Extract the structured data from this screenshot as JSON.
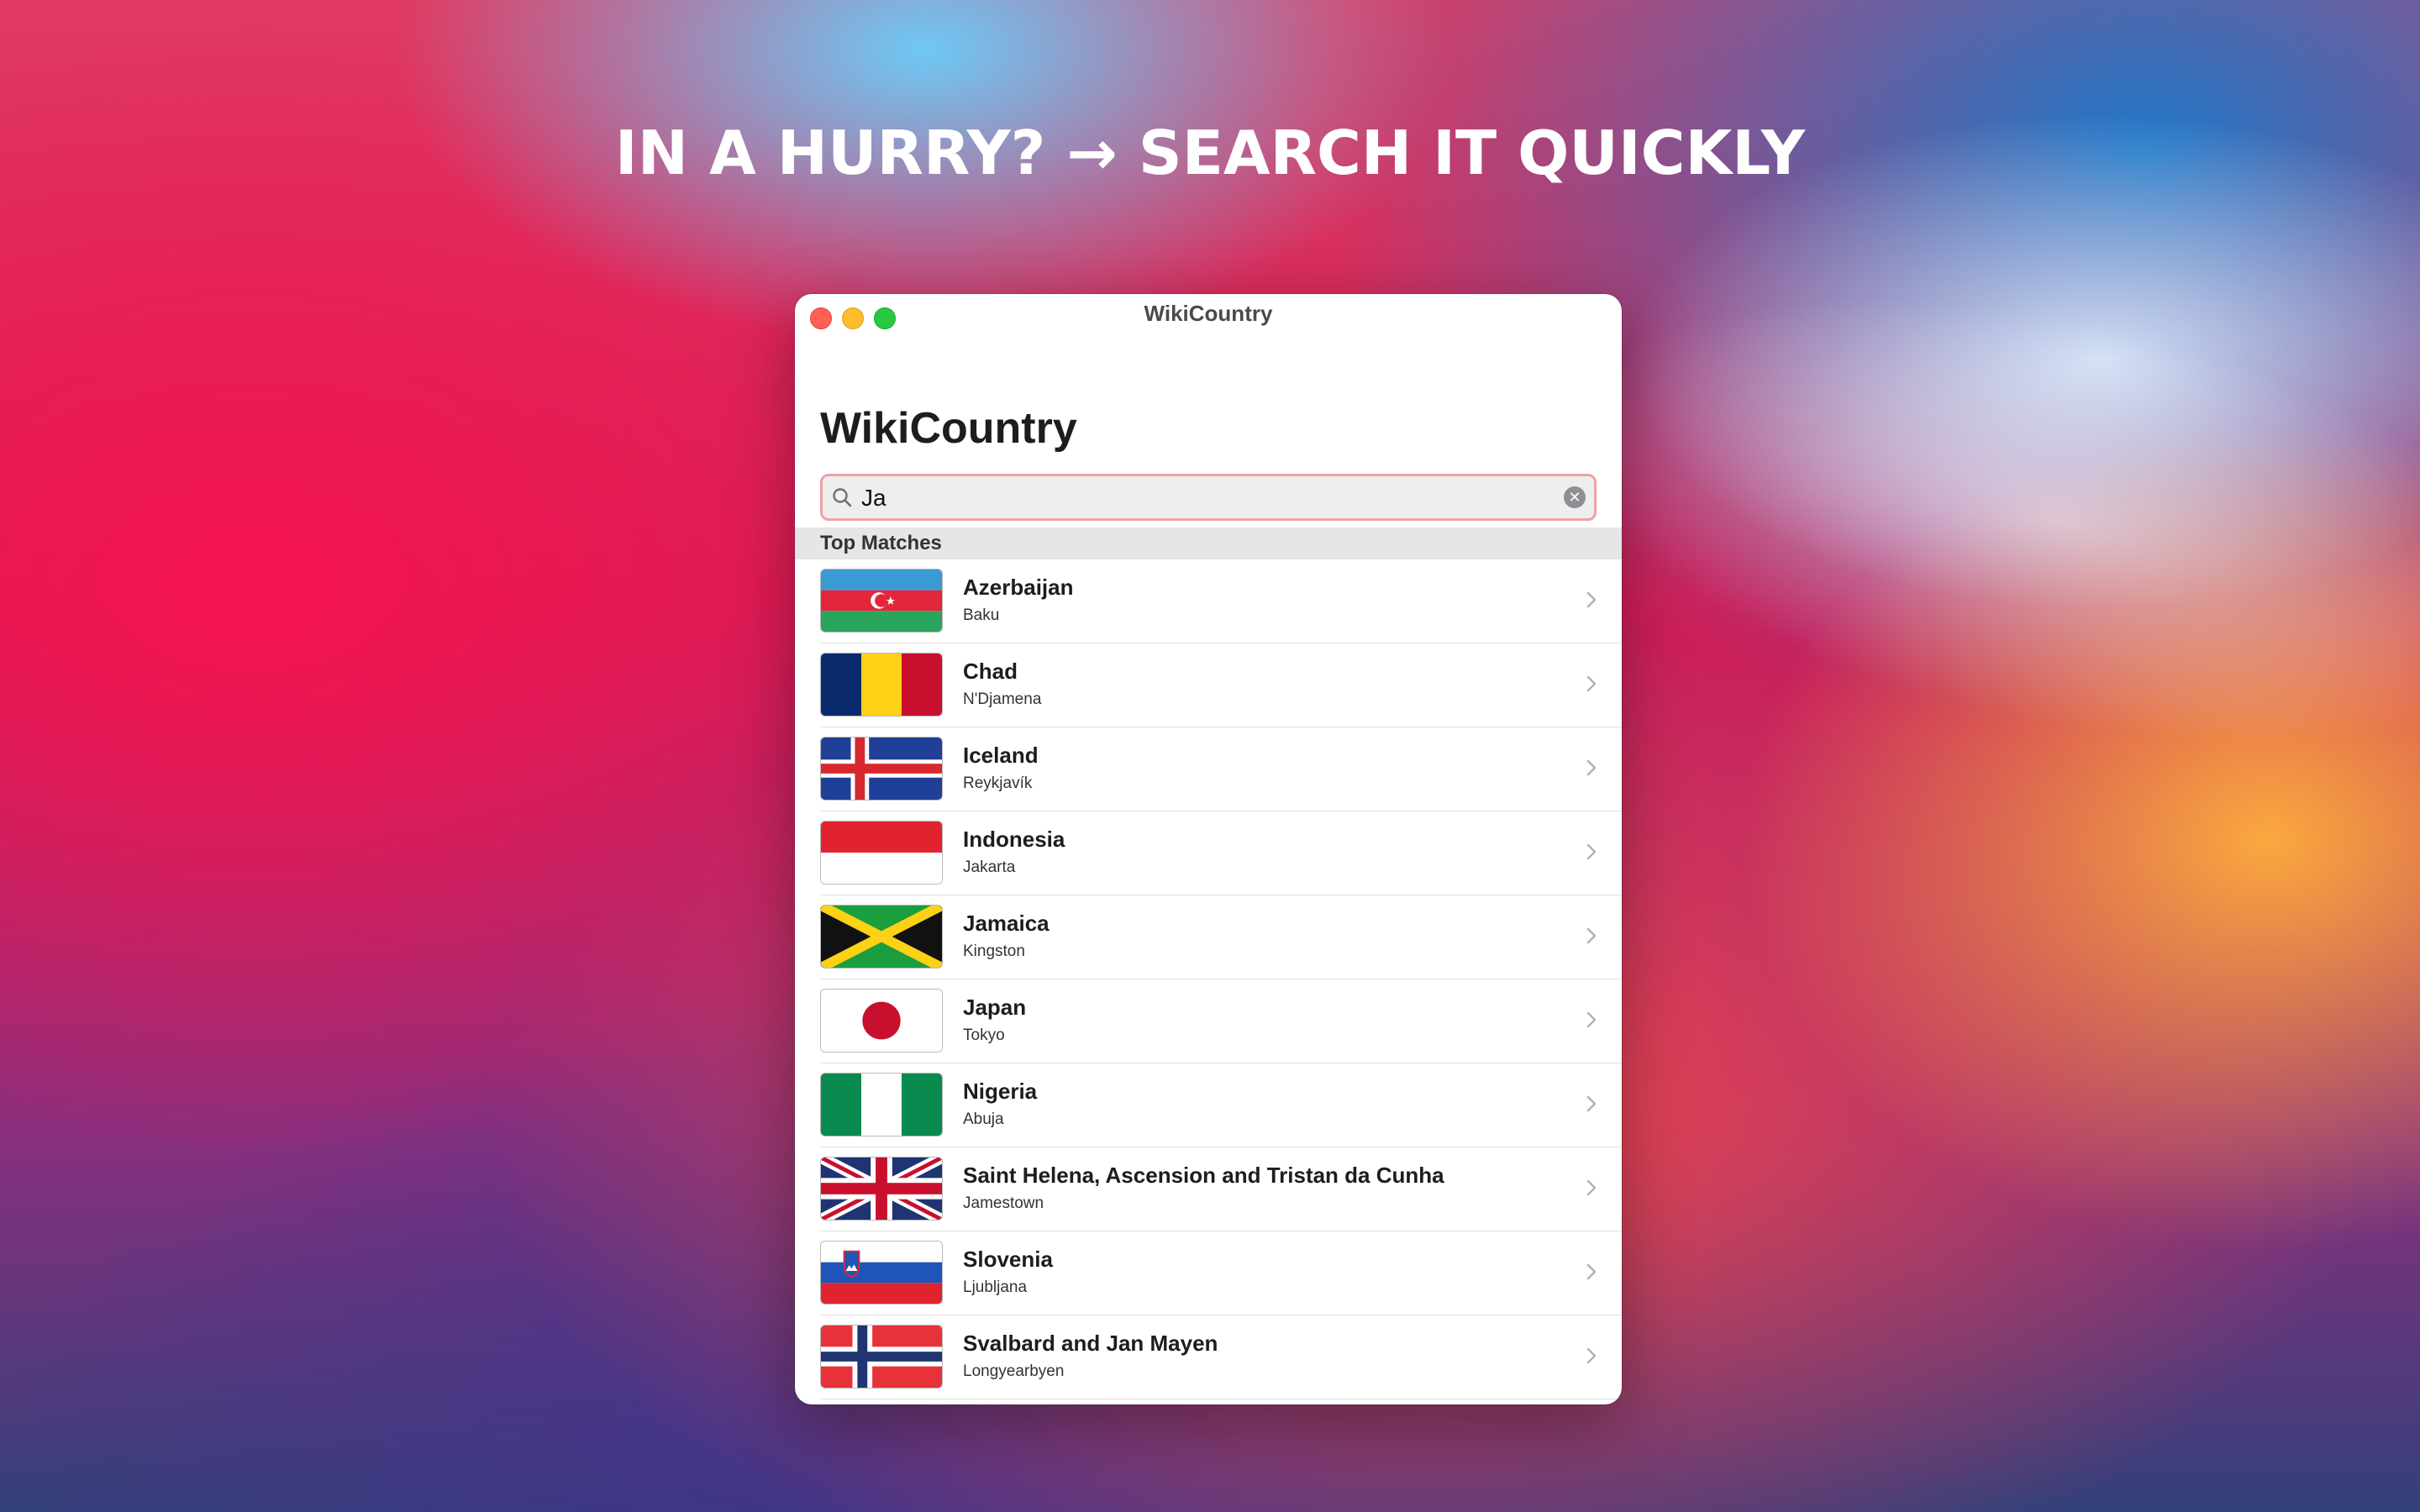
{
  "headline": "IN A HURRY? → SEARCH IT QUICKLY",
  "window": {
    "title": "WikiCountry"
  },
  "app": {
    "title": "WikiCountry"
  },
  "search": {
    "value": "Ja",
    "icon": "magnifier-icon",
    "clear_icon": "clear-circle-icon"
  },
  "section": {
    "title": "Top Matches"
  },
  "countries": [
    {
      "name": "Azerbaijan",
      "capital": "Baku",
      "flag": "azerbaijan-flag-icon"
    },
    {
      "name": "Chad",
      "capital": "N'Djamena",
      "flag": "chad-flag-icon"
    },
    {
      "name": "Iceland",
      "capital": "Reykjavík",
      "flag": "iceland-flag-icon"
    },
    {
      "name": "Indonesia",
      "capital": "Jakarta",
      "flag": "indonesia-flag-icon"
    },
    {
      "name": "Jamaica",
      "capital": "Kingston",
      "flag": "jamaica-flag-icon"
    },
    {
      "name": "Japan",
      "capital": "Tokyo",
      "flag": "japan-flag-icon"
    },
    {
      "name": "Nigeria",
      "capital": "Abuja",
      "flag": "nigeria-flag-icon"
    },
    {
      "name": "Saint Helena, Ascension and Tristan da Cunha",
      "capital": "Jamestown",
      "flag": "uk-flag-icon"
    },
    {
      "name": "Slovenia",
      "capital": "Ljubljana",
      "flag": "slovenia-flag-icon"
    },
    {
      "name": "Svalbard and Jan Mayen",
      "capital": "Longyearbyen",
      "flag": "norway-flag-icon"
    }
  ],
  "colors": {
    "search_focus_ring": "#f2a0a8",
    "close": "#fe5f57",
    "minimize": "#febc2e",
    "zoom": "#28c840"
  }
}
